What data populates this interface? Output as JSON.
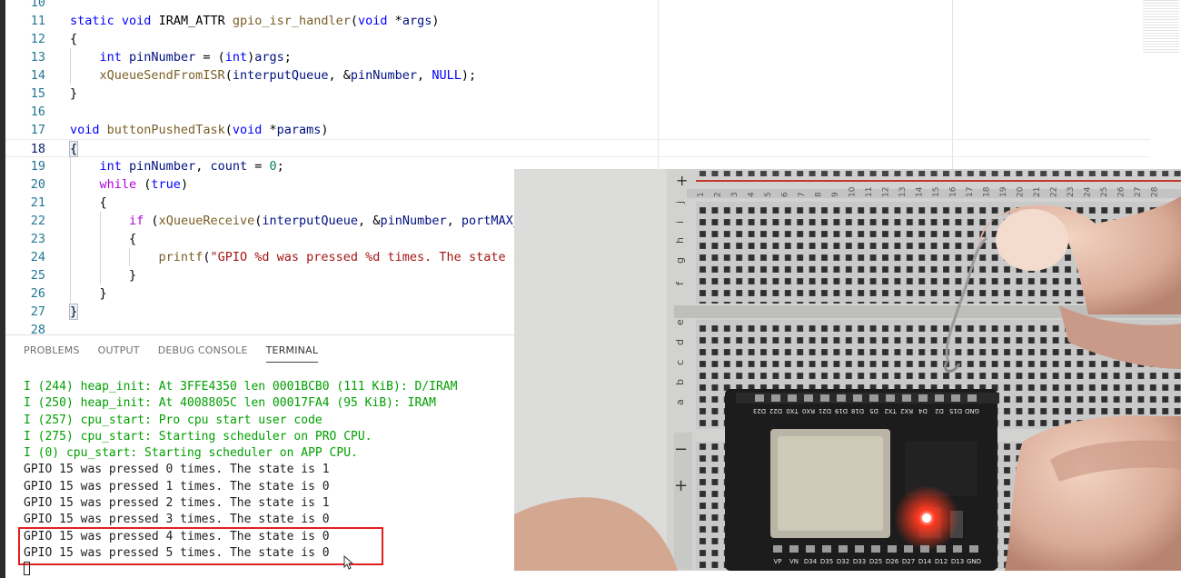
{
  "editor": {
    "lines": [
      {
        "n": "10",
        "html": ""
      },
      {
        "n": "11",
        "html": "<span class=\"kw\">static</span> <span class=\"kw\">void</span> IRAM_ATTR <span class=\"fn\">gpio_isr_handler</span>(<span class=\"kw\">void</span> *<span class=\"var\">args</span>)"
      },
      {
        "n": "12",
        "html": "{"
      },
      {
        "n": "13",
        "html": "    <span class=\"kw\">int</span> <span class=\"var\">pinNumber</span> = (<span class=\"kw\">int</span>)<span class=\"var\">args</span>;"
      },
      {
        "n": "14",
        "html": "    <span class=\"fn\">xQueueSendFromISR</span>(<span class=\"var\">interputQueue</span>, &amp;<span class=\"var\">pinNumber</span>, <span class=\"kw\">NULL</span>);"
      },
      {
        "n": "15",
        "html": "}"
      },
      {
        "n": "16",
        "html": ""
      },
      {
        "n": "17",
        "html": "<span class=\"kw\">void</span> <span class=\"fn\">buttonPushedTask</span>(<span class=\"kw\">void</span> *<span class=\"var\">params</span>)"
      },
      {
        "n": "18",
        "html": "<span class=\"brk\">{</span>"
      },
      {
        "n": "19",
        "html": "    <span class=\"kw\">int</span> <span class=\"var\">pinNumber</span>, <span class=\"var\">count</span> = <span class=\"num\">0</span>;"
      },
      {
        "n": "20",
        "html": "    <span class=\"ctrl\">while</span> (<span class=\"kw\">true</span>)"
      },
      {
        "n": "21",
        "html": "    {"
      },
      {
        "n": "22",
        "html": "        <span class=\"ctrl\">if</span> (<span class=\"fn\">xQueueReceive</span>(<span class=\"var\">interputQueue</span>, &amp;<span class=\"var\">pinNumber</span>, <span class=\"var\">portMAX_</span>"
      },
      {
        "n": "23",
        "html": "        {"
      },
      {
        "n": "24",
        "html": "            <span class=\"fn\">printf</span>(<span class=\"str\">\"GPIO %d was pressed %d times. The state i</span>"
      },
      {
        "n": "25",
        "html": "        }"
      },
      {
        "n": "26",
        "html": "    }"
      },
      {
        "n": "27",
        "html": "<span class=\"brk\">}</span>"
      },
      {
        "n": "28",
        "html": ""
      }
    ],
    "current_line": "18"
  },
  "panel": {
    "tabs": [
      "PROBLEMS",
      "OUTPUT",
      "DEBUG CONSOLE",
      "TERMINAL"
    ],
    "active_tab": "TERMINAL",
    "terminal_lines": [
      {
        "text": "I (244) heap_init: At 3FFE4350 len 0001BCB0 (111 KiB): D/IRAM",
        "kind": "info"
      },
      {
        "text": "I (250) heap_init: At 4008805C len 00017FA4 (95 KiB): IRAM",
        "kind": "info"
      },
      {
        "text": "I (257) cpu_start: Pro cpu start user code",
        "kind": "info"
      },
      {
        "text": "I (275) cpu_start: Starting scheduler on PRO CPU.",
        "kind": "info"
      },
      {
        "text": "I (0) cpu_start: Starting scheduler on APP CPU.",
        "kind": "info"
      },
      {
        "text": "GPIO 15 was pressed 0 times. The state is 1",
        "kind": "plain"
      },
      {
        "text": "GPIO 15 was pressed 1 times. The state is 0",
        "kind": "plain"
      },
      {
        "text": "GPIO 15 was pressed 2 times. The state is 1",
        "kind": "plain"
      },
      {
        "text": "GPIO 15 was pressed 3 times. The state is 0",
        "kind": "plain"
      },
      {
        "text": "GPIO 15 was pressed 4 times. The state is 0",
        "kind": "plain"
      },
      {
        "text": "GPIO 15 was pressed 5 times. The state is 0",
        "kind": "plain"
      }
    ]
  },
  "photo": {
    "breadboard_row_letters": [
      "j",
      "i",
      "h",
      "g",
      "f",
      "e",
      "d",
      "c",
      "b",
      "a"
    ],
    "column_numbers": [
      "1",
      "2",
      "3",
      "4",
      "5",
      "6",
      "7",
      "8",
      "9",
      "10",
      "11",
      "12",
      "13",
      "14",
      "15",
      "16",
      "17",
      "18",
      "19",
      "20",
      "21",
      "22",
      "23",
      "24",
      "25",
      "26",
      "27",
      "28"
    ],
    "rail_plus": "+",
    "rail_minus": "−",
    "board_top_pins": [
      "D23",
      "D22",
      "TX0",
      "RX0",
      "D21",
      "D19",
      "D18",
      "D5",
      "TX2",
      "RX2",
      "D4",
      "D2",
      "D15",
      "GND"
    ],
    "board_bottom_pins": [
      "VP",
      "VN",
      "D34",
      "D35",
      "D32",
      "D33",
      "D25",
      "D26",
      "D27",
      "D14",
      "D12",
      "D13",
      "GND"
    ]
  },
  "colors": {
    "keyword": "#0000ff",
    "function": "#795e26",
    "variable": "#001080",
    "number": "#098658",
    "string": "#a31515",
    "control": "#af00db",
    "line_number": "#237893",
    "terminal_info": "#00a000",
    "highlight_box": "#e02020",
    "led": "#ff2a1a"
  }
}
